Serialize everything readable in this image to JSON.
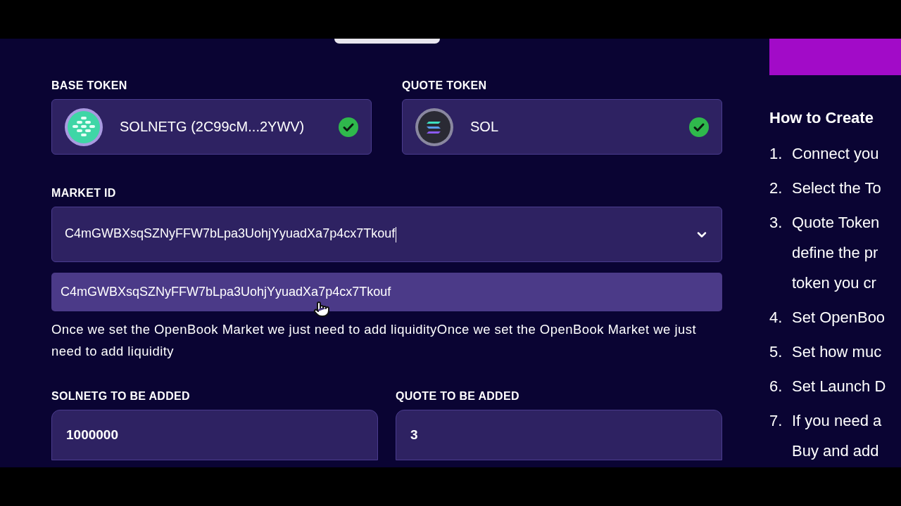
{
  "base_token": {
    "label": "BASE TOKEN",
    "name": "SOLNETG (2C99cM...2YWV)",
    "verified": true
  },
  "quote_token": {
    "label": "QUOTE TOKEN",
    "name": "SOL",
    "verified": true
  },
  "market_id": {
    "label": "MARKET ID",
    "value": "C4mGWBXsqSZNyFFW7bLpa3UohjYyuadXa7p4cx7Tkouf",
    "expanded": true
  },
  "suggestions": [
    {
      "text": "C4mGWBXsqSZNyFFW7bLpa3UohjYyuadXa7p4cx7Tkouf",
      "highlighted": true
    }
  ],
  "description": "Once we set the OpenBook Market we just need to add liquidityOnce we set the OpenBook Market we just need to add liquidity",
  "amounts": [
    {
      "label": "SOLNETG TO BE ADDED",
      "value": "1000000"
    },
    {
      "label": "QUOTE TO BE ADDED",
      "value": "3"
    }
  ],
  "guide": {
    "title": "How to Create",
    "steps": [
      {
        "number": "1.",
        "lines": [
          "Connect you"
        ]
      },
      {
        "number": "2.",
        "lines": [
          "Select the To"
        ]
      },
      {
        "number": "3.",
        "lines": [
          "Quote Token",
          "define the pr",
          "token you cr"
        ]
      },
      {
        "number": "4.",
        "lines": [
          "Set OpenBoo"
        ]
      },
      {
        "number": "5.",
        "lines": [
          "Set how muc"
        ]
      },
      {
        "number": "6.",
        "lines": [
          "Set Launch D"
        ]
      },
      {
        "number": "7.",
        "lines": [
          "If you need a",
          "Buy and add"
        ]
      }
    ]
  }
}
